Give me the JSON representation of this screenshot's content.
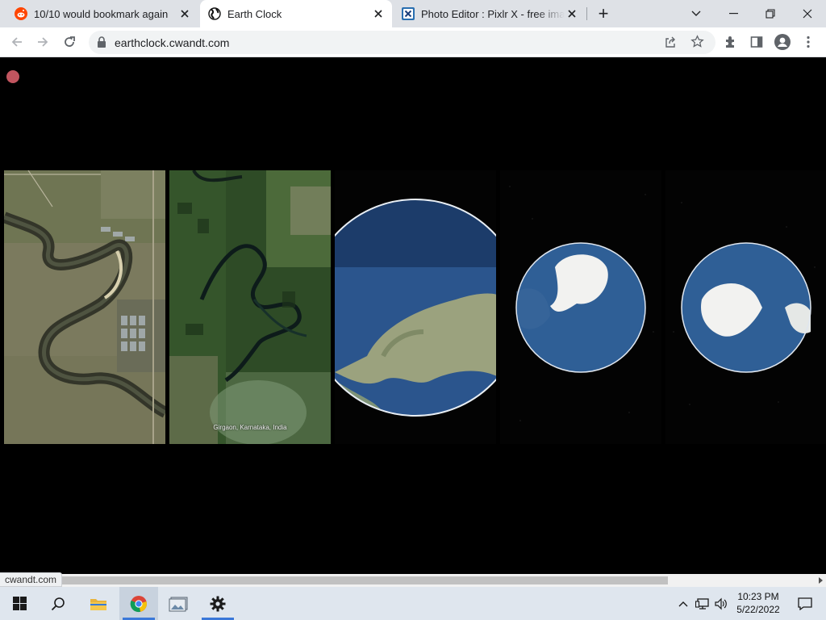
{
  "browser": {
    "tabs": [
      {
        "title": "10/10 would bookmark again",
        "favicon": "reddit-icon",
        "active": false
      },
      {
        "title": "Earth Clock",
        "favicon": "globe-icon",
        "active": true
      },
      {
        "title": "Photo Editor : Pixlr X - free image",
        "favicon": "pixlr-icon",
        "active": false
      }
    ],
    "new_tab": "+",
    "url": "earthclock.cwandt.com",
    "status_url": "cwandt.com"
  },
  "page": {
    "location_label": "Girgaon, Karnataka, India",
    "panels": [
      {
        "kind": "satellite-close"
      },
      {
        "kind": "satellite-mid"
      },
      {
        "kind": "globe-near"
      },
      {
        "kind": "globe-far"
      },
      {
        "kind": "globe-far"
      }
    ]
  },
  "taskbar": {
    "time": "10:23 PM",
    "date": "5/22/2022",
    "pinned": [
      "windows-start-icon",
      "search-icon",
      "file-explorer-icon",
      "chrome-icon",
      "photos-icon",
      "settings-icon"
    ]
  },
  "colors": {
    "tab_strip": "#dee1e6",
    "record_dot": "#c2555f",
    "ocean": "#2f5f96",
    "ice": "#f2f2f0"
  }
}
